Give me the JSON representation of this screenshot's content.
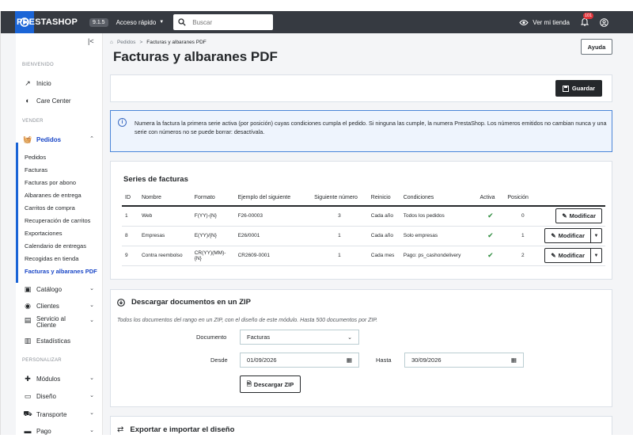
{
  "topbar": {
    "logo_text": "PRESTASHOP",
    "version": "9.1.5",
    "quick_access": "Acceso rápido",
    "search_placeholder": "Buscar",
    "view_store": "Ver mi tienda",
    "notifications_count": "101"
  },
  "sidebar": {
    "sections": {
      "welcome": "BIENVENIDO",
      "sell": "VENDER",
      "customize": "PERSONALIZAR"
    },
    "welcome_items": [
      {
        "label": "Inicio",
        "icon": "trend-icon"
      },
      {
        "label": "Care Center",
        "icon": "care-icon"
      }
    ],
    "orders": {
      "label": "Pedidos",
      "icon": "basket-icon",
      "subitems": [
        "Pedidos",
        "Facturas",
        "Facturas por abono",
        "Albaranes de entrega",
        "Carritos de compra",
        "Recuperación de carritos",
        "Exportaciones",
        "Calendario de entregas",
        "Recogidas en tienda",
        "Facturas y albaranes PDF"
      ]
    },
    "sell_items": [
      {
        "label": "Catálogo",
        "icon": "store-icon"
      },
      {
        "label": "Clientes",
        "icon": "user-icon"
      },
      {
        "label": "Servicio al",
        "label2": "Cliente",
        "icon": "chat-icon"
      },
      {
        "label": "Estadísticas",
        "icon": "stats-icon"
      }
    ],
    "customize_items": [
      {
        "label": "Módulos",
        "icon": "puzzle-icon"
      },
      {
        "label": "Diseño",
        "icon": "monitor-icon"
      },
      {
        "label": "Transporte",
        "icon": "truck-icon"
      },
      {
        "label": "Pago",
        "icon": "card-icon"
      }
    ]
  },
  "breadcrumb": {
    "home": "Pedidos",
    "separator": ">",
    "current": "Facturas y albaranes PDF"
  },
  "page_title": "Facturas y albaranes PDF",
  "help_label": "Ayuda",
  "save_label": "Guardar",
  "info_text": "Numera la factura la primera serie activa (por posición) cuyas condiciones cumpla el pedido. Si ninguna las cumple, la numera PrestaShop. Los números emitidos no cambian nunca y una serie con números no se puede borrar: desactívala.",
  "series": {
    "title": "Series de facturas",
    "headers": [
      "ID",
      "Nombre",
      "Formato",
      "Ejemplo del siguiente",
      "Siguiente número",
      "Reinicio",
      "Condiciones",
      "Activa",
      "Posición"
    ],
    "rows": [
      {
        "id": "1",
        "name": "Web",
        "format": "F(YY)-{N}",
        "example": "F26-00003",
        "next": "3",
        "reset": "Cada año",
        "conditions": "Todos los pedidos",
        "position": "0",
        "split": false
      },
      {
        "id": "8",
        "name": "Empresas",
        "format": "E(YY)/{N}",
        "example": "E26/0001",
        "next": "1",
        "reset": "Cada año",
        "conditions": "Solo empresas",
        "position": "1",
        "split": true
      },
      {
        "id": "9",
        "name": "Contra reembolso",
        "format": "CR(YY)(MM)-{N}",
        "example": "CR2609-0001",
        "next": "1",
        "reset": "Cada mes",
        "conditions": "Pago: ps_cashondelivery",
        "position": "2",
        "split": true
      }
    ],
    "modify_label": "Modificar"
  },
  "zip": {
    "title": "Descargar documentos en un ZIP",
    "description": "Todos los documentos del rango en un ZIP, con el diseño de este módulo. Hasta 500 documentos por ZIP.",
    "document_label": "Documento",
    "document_value": "Facturas",
    "from_label": "Desde",
    "from_value": "01/09/2026",
    "to_label": "Hasta",
    "to_value": "30/09/2026",
    "button_label": "Descargar ZIP"
  },
  "export": {
    "title": "Exportar e importar el diseño"
  }
}
